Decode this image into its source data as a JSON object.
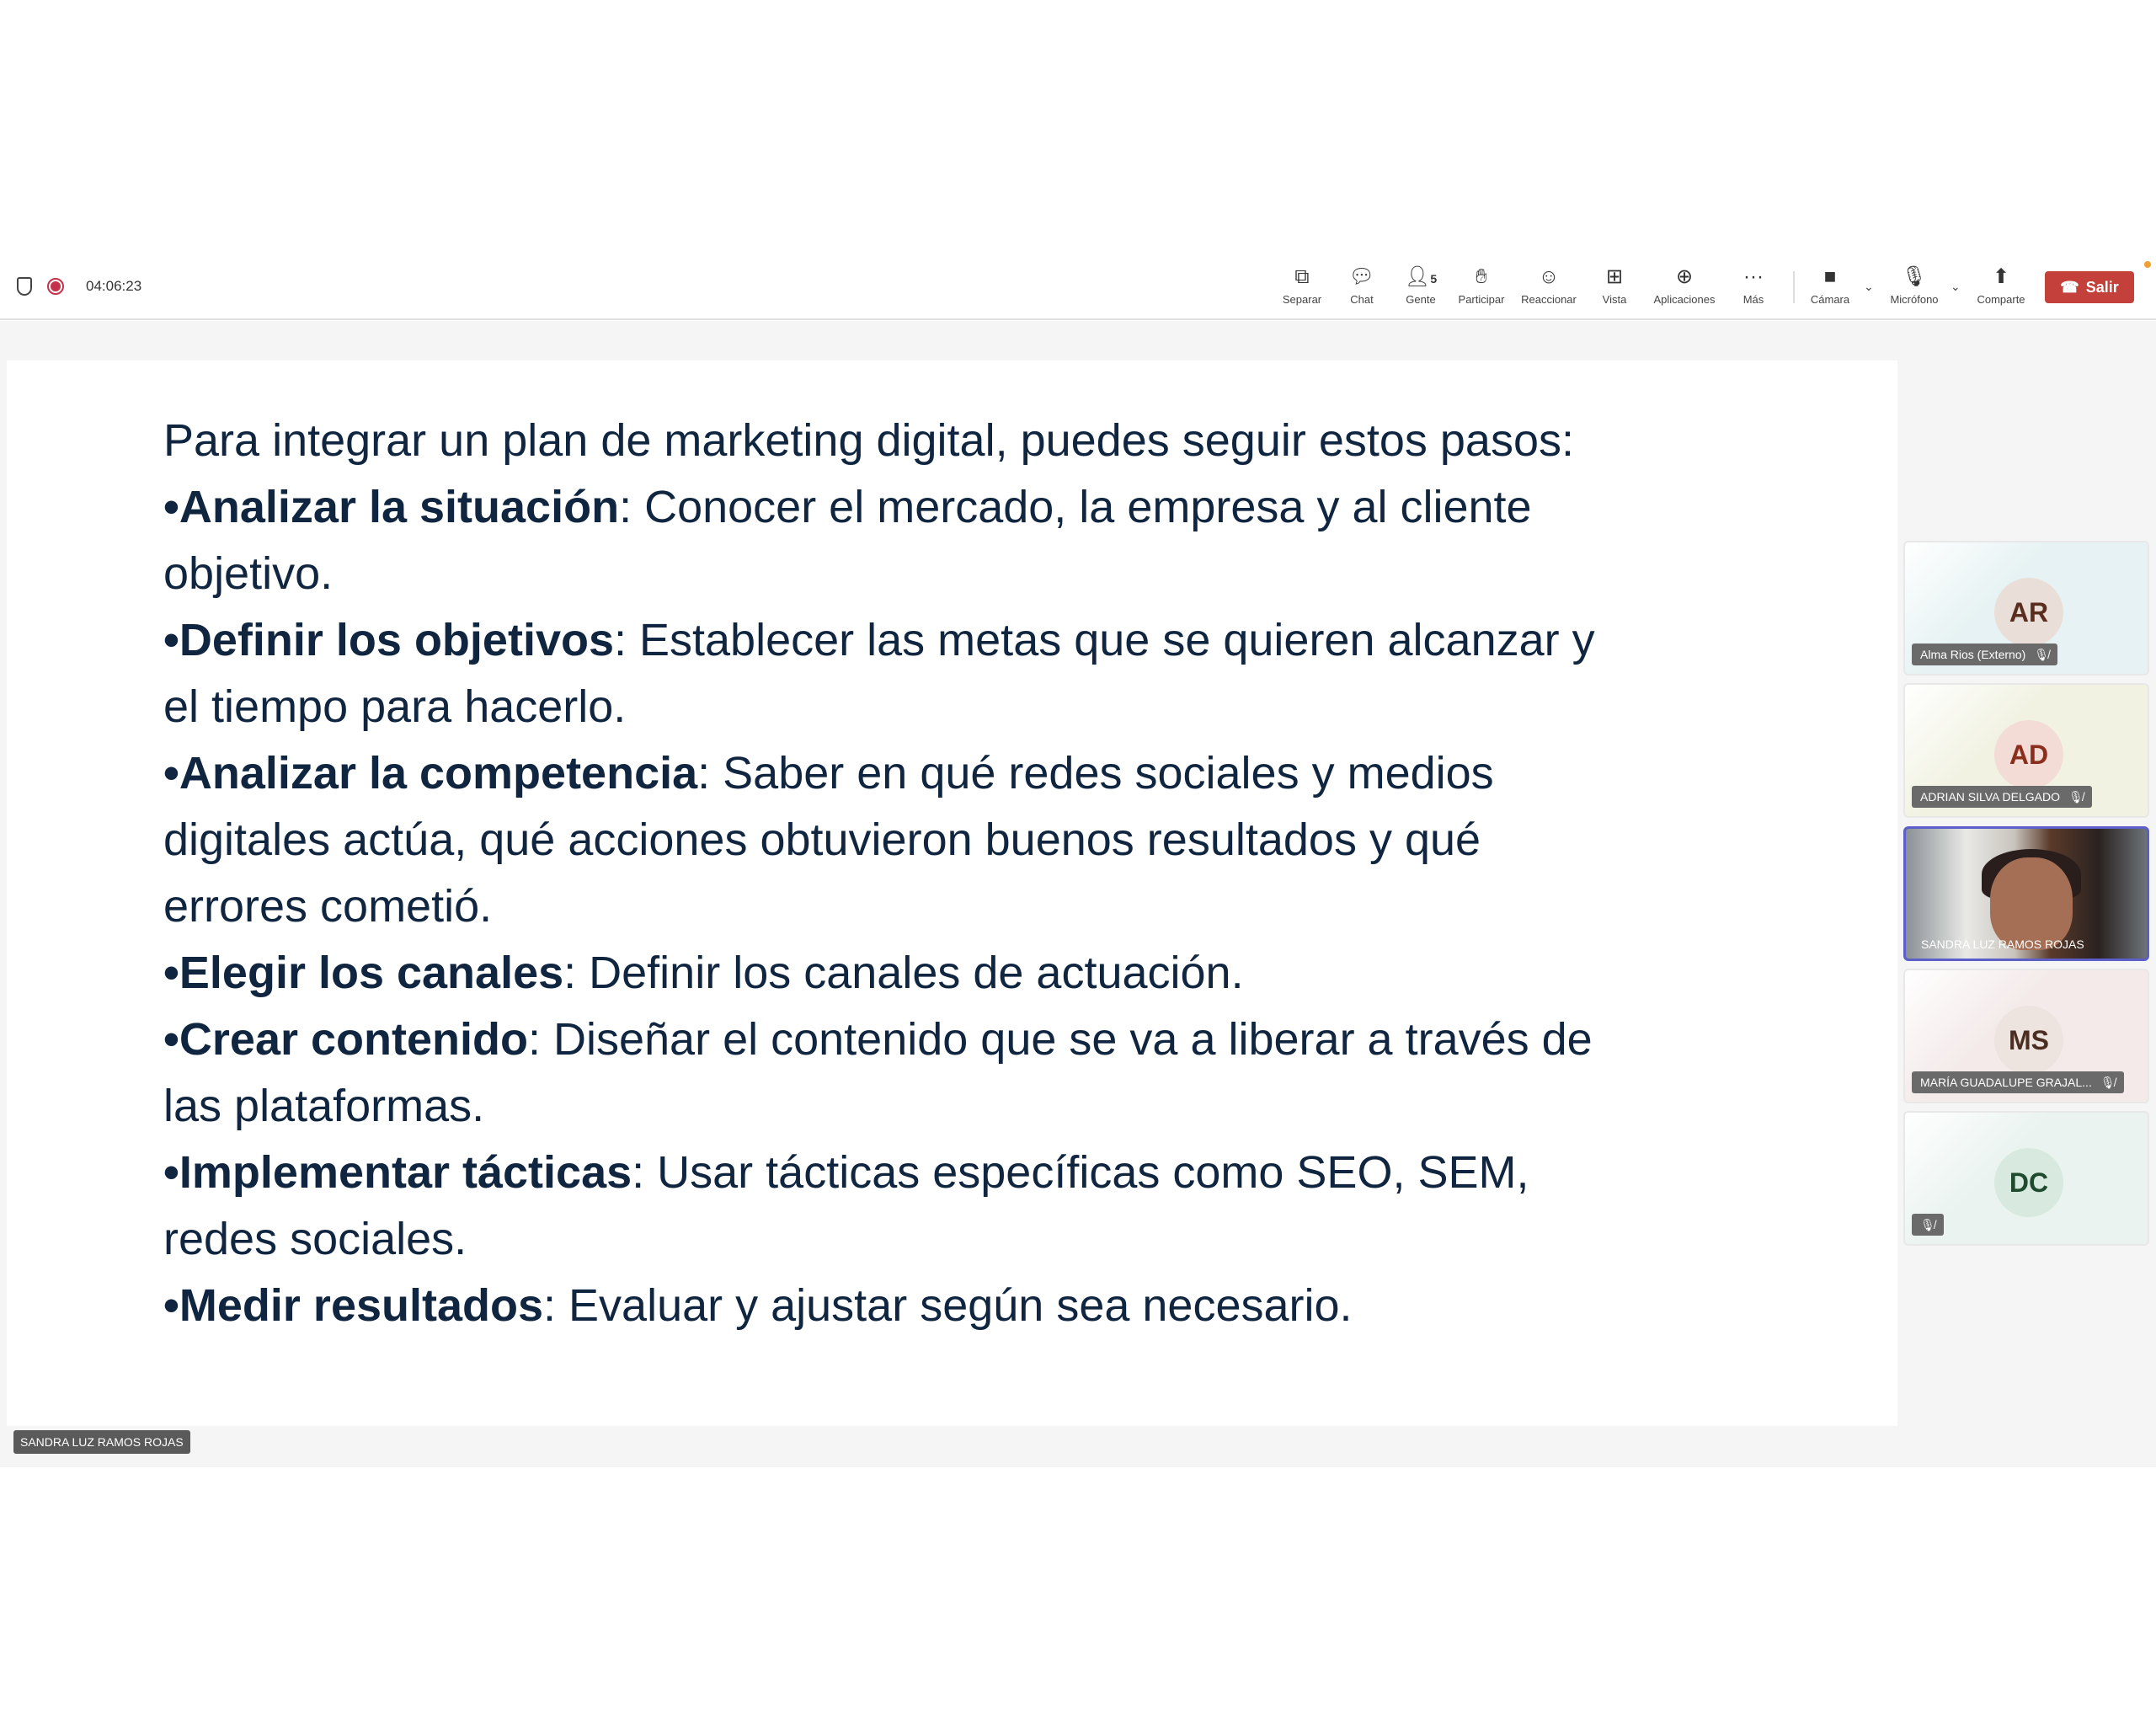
{
  "meeting": {
    "timer": "04:06:23"
  },
  "toolbar": {
    "items": [
      {
        "label": "Separar",
        "icon": "pop-out-icon"
      },
      {
        "label": "Chat",
        "icon": "chat-icon"
      },
      {
        "label": "Gente",
        "icon": "people-icon",
        "badge": "5"
      },
      {
        "label": "Participar",
        "icon": "raise-hand-icon"
      },
      {
        "label": "Reaccionar",
        "icon": "smiley-icon"
      },
      {
        "label": "Vista",
        "icon": "grid-view-icon"
      },
      {
        "label": "Aplicaciones",
        "icon": "add-app-icon"
      },
      {
        "label": "Más",
        "icon": "more-icon"
      },
      {
        "label": "Cámara",
        "icon": "camera-off-icon"
      },
      {
        "label": "Micrófono",
        "icon": "mic-off-icon"
      },
      {
        "label": "Comparte",
        "icon": "share-icon"
      }
    ],
    "leave_label": "Salir",
    "leave_color": "#c4403b"
  },
  "slide": {
    "intro": "Para integrar un plan de marketing digital, puedes seguir estos pasos:",
    "bullets": [
      {
        "term": "Analizar la situación",
        "lines": [
          ": Conocer el mercado, la empresa y al cliente",
          "objetivo."
        ]
      },
      {
        "term": "Definir los objetivos",
        "lines": [
          ": Establecer las metas que se quieren alcanzar y",
          "el tiempo para hacerlo."
        ]
      },
      {
        "term": "Analizar la competencia",
        "lines": [
          ": Saber en qué redes sociales y medios",
          "digitales actúa, qué acciones obtuvieron buenos resultados y qué",
          "errores cometió."
        ]
      },
      {
        "term": "Elegir los canales",
        "lines": [
          ": Definir los canales de actuación."
        ]
      },
      {
        "term": "Crear contenido",
        "lines": [
          ": Diseñar el contenido que se va a liberar a través de",
          "las plataformas."
        ]
      },
      {
        "term": "Implementar tácticas",
        "lines": [
          ": Usar tácticas específicas como SEO, SEM,",
          "redes sociales."
        ]
      },
      {
        "term": "Medir resultados",
        "lines": [
          ": Evaluar y ajustar según sea necesario."
        ]
      }
    ]
  },
  "presenter_tag": "SANDRA LUZ RAMOS ROJAS",
  "participants": [
    {
      "initials": "AR",
      "name": "Alma Rios (Externo)",
      "muted": true,
      "bg": "#e6f2f3",
      "avatar_bg": "#eadfd8",
      "avatar_fg": "#5a2e1e"
    },
    {
      "initials": "AD",
      "name": "ADRIAN SILVA DELGADO",
      "muted": true,
      "bg": "#f1f2e2",
      "avatar_bg": "#f4dcd6",
      "avatar_fg": "#8a2e1e"
    },
    {
      "initials": "",
      "name": "SANDRA LUZ RAMOS ROJAS",
      "muted": false,
      "video": true
    },
    {
      "initials": "MS",
      "name": "MARÍA GUADALUPE GRAJAL...",
      "muted": true,
      "bg": "#f4eaea",
      "avatar_bg": "#ede3df",
      "avatar_fg": "#4a2e22"
    },
    {
      "initials": "DC",
      "name": "",
      "muted": true,
      "bg": "#eaf3f0",
      "avatar_bg": "#d8e9df",
      "avatar_fg": "#1e4a2e"
    }
  ]
}
